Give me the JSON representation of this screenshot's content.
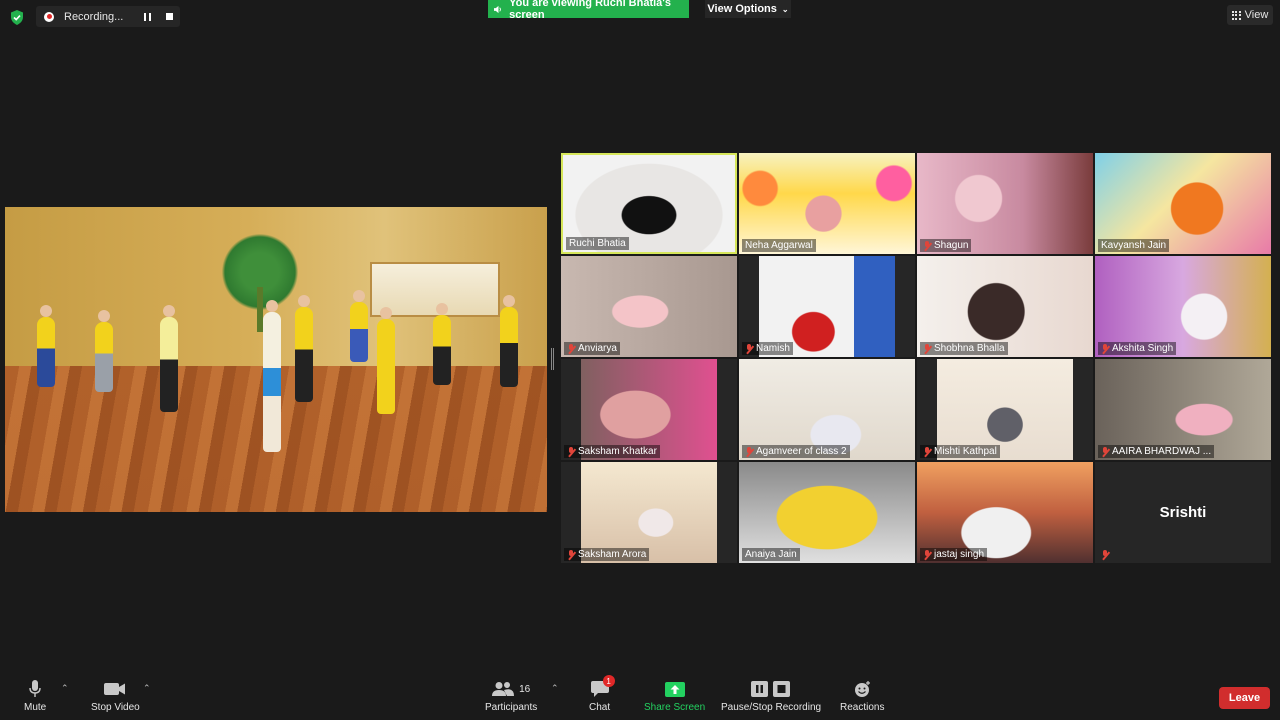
{
  "top_bar": {
    "recording_label": "Recording...",
    "viewing_banner": "You are viewing Ruchi Bhatia's screen",
    "view_options_label": "View Options",
    "view_label": "View"
  },
  "gallery": {
    "participants": [
      {
        "name": "Ruchi Bhatia",
        "muted": false,
        "active_speaker": true
      },
      {
        "name": "Neha Aggarwal",
        "muted": false
      },
      {
        "name": "Shagun",
        "muted": true
      },
      {
        "name": "Kavyansh Jain",
        "muted": false
      },
      {
        "name": "Anviarya",
        "muted": true
      },
      {
        "name": "Namish",
        "muted": true
      },
      {
        "name": "Shobhna Bhalla",
        "muted": true
      },
      {
        "name": "Akshita Singh",
        "muted": true
      },
      {
        "name": "Saksham Khatkar",
        "muted": true
      },
      {
        "name": "Agamveer of class 2",
        "muted": true
      },
      {
        "name": "Mishti Kathpal",
        "muted": true
      },
      {
        "name": "AAIRA BHARDWAJ ...",
        "muted": true
      },
      {
        "name": "Saksham Arora",
        "muted": true
      },
      {
        "name": "Anaiya Jain",
        "muted": false
      },
      {
        "name": "jastaj singh",
        "muted": true
      },
      {
        "name": "Srishti",
        "muted": true,
        "video_off": true
      }
    ]
  },
  "toolbar": {
    "mute_label": "Mute",
    "stop_video_label": "Stop Video",
    "participants_label": "Participants",
    "participants_count": "16",
    "chat_label": "Chat",
    "chat_badge": "1",
    "share_screen_label": "Share Screen",
    "pause_stop_recording_label": "Pause/Stop Recording",
    "reactions_label": "Reactions",
    "leave_label": "Leave"
  },
  "colors": {
    "background": "#1a1a1a",
    "share_green": "#23b14d",
    "active_speaker_border": "#d6e65a",
    "leave_red": "#d12d2d",
    "muted_red": "#e0453a"
  }
}
